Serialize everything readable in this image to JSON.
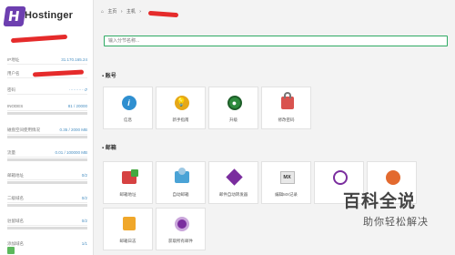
{
  "brand": {
    "name": "Hostinger",
    "mark": "H"
  },
  "sidebar": {
    "rows": [
      {
        "label": "IP地址",
        "value": "31.170.165.24"
      },
      {
        "label": "用户名",
        "value": ""
      },
      {
        "label": "密码",
        "value": "··········  ↺"
      },
      {
        "label": "INODES",
        "value": "81 / 20000"
      },
      {
        "label": "磁盘空间使用情况",
        "value": "0.35 / 2000 MB"
      },
      {
        "label": "流量",
        "value": "0.01 / 100000 MB"
      },
      {
        "label": "邮箱地址",
        "value": "0/2"
      },
      {
        "label": "二级域名",
        "value": "0/2"
      },
      {
        "label": "驻留域名",
        "value": "0/2"
      },
      {
        "label": "添加域名",
        "value": "1/1"
      }
    ]
  },
  "breadcrumb": {
    "home": "主页",
    "sep1": "›",
    "host": "主机",
    "sep2": "›"
  },
  "search": {
    "placeholder": "输入分节名称..."
  },
  "sections": {
    "account": "账号",
    "email": "邮箱"
  },
  "account_tiles": [
    {
      "label": "信息",
      "icon": "info-icon",
      "color": "#2f8fd0"
    },
    {
      "label": "新手指南",
      "icon": "lightbulb-icon",
      "color": "#e6a817"
    },
    {
      "label": "升级",
      "icon": "upgrade-icon",
      "color": "#2e8b3d"
    },
    {
      "label": "修改密码",
      "icon": "lock-icon",
      "color": "#d9534f"
    }
  ],
  "email_tiles": [
    {
      "label": "邮箱地址",
      "icon": "email-address-icon"
    },
    {
      "label": "自动邮箱",
      "icon": "auto-mail-icon"
    },
    {
      "label": "邮件自动转发器",
      "icon": "forwarder-icon"
    },
    {
      "label": "编辑MX记录",
      "icon": "mx-record-icon",
      "text": "MX"
    },
    {
      "label": "",
      "icon": "mail-tile-5-icon"
    },
    {
      "label": "",
      "icon": "mail-tile-6-icon"
    },
    {
      "label": "邮箱日志",
      "icon": "mail-log-icon"
    },
    {
      "label": "获取所有邮件",
      "icon": "fetch-mail-icon"
    }
  ],
  "watermark": {
    "line1": "百科全说",
    "line2": "助你轻松解决"
  }
}
